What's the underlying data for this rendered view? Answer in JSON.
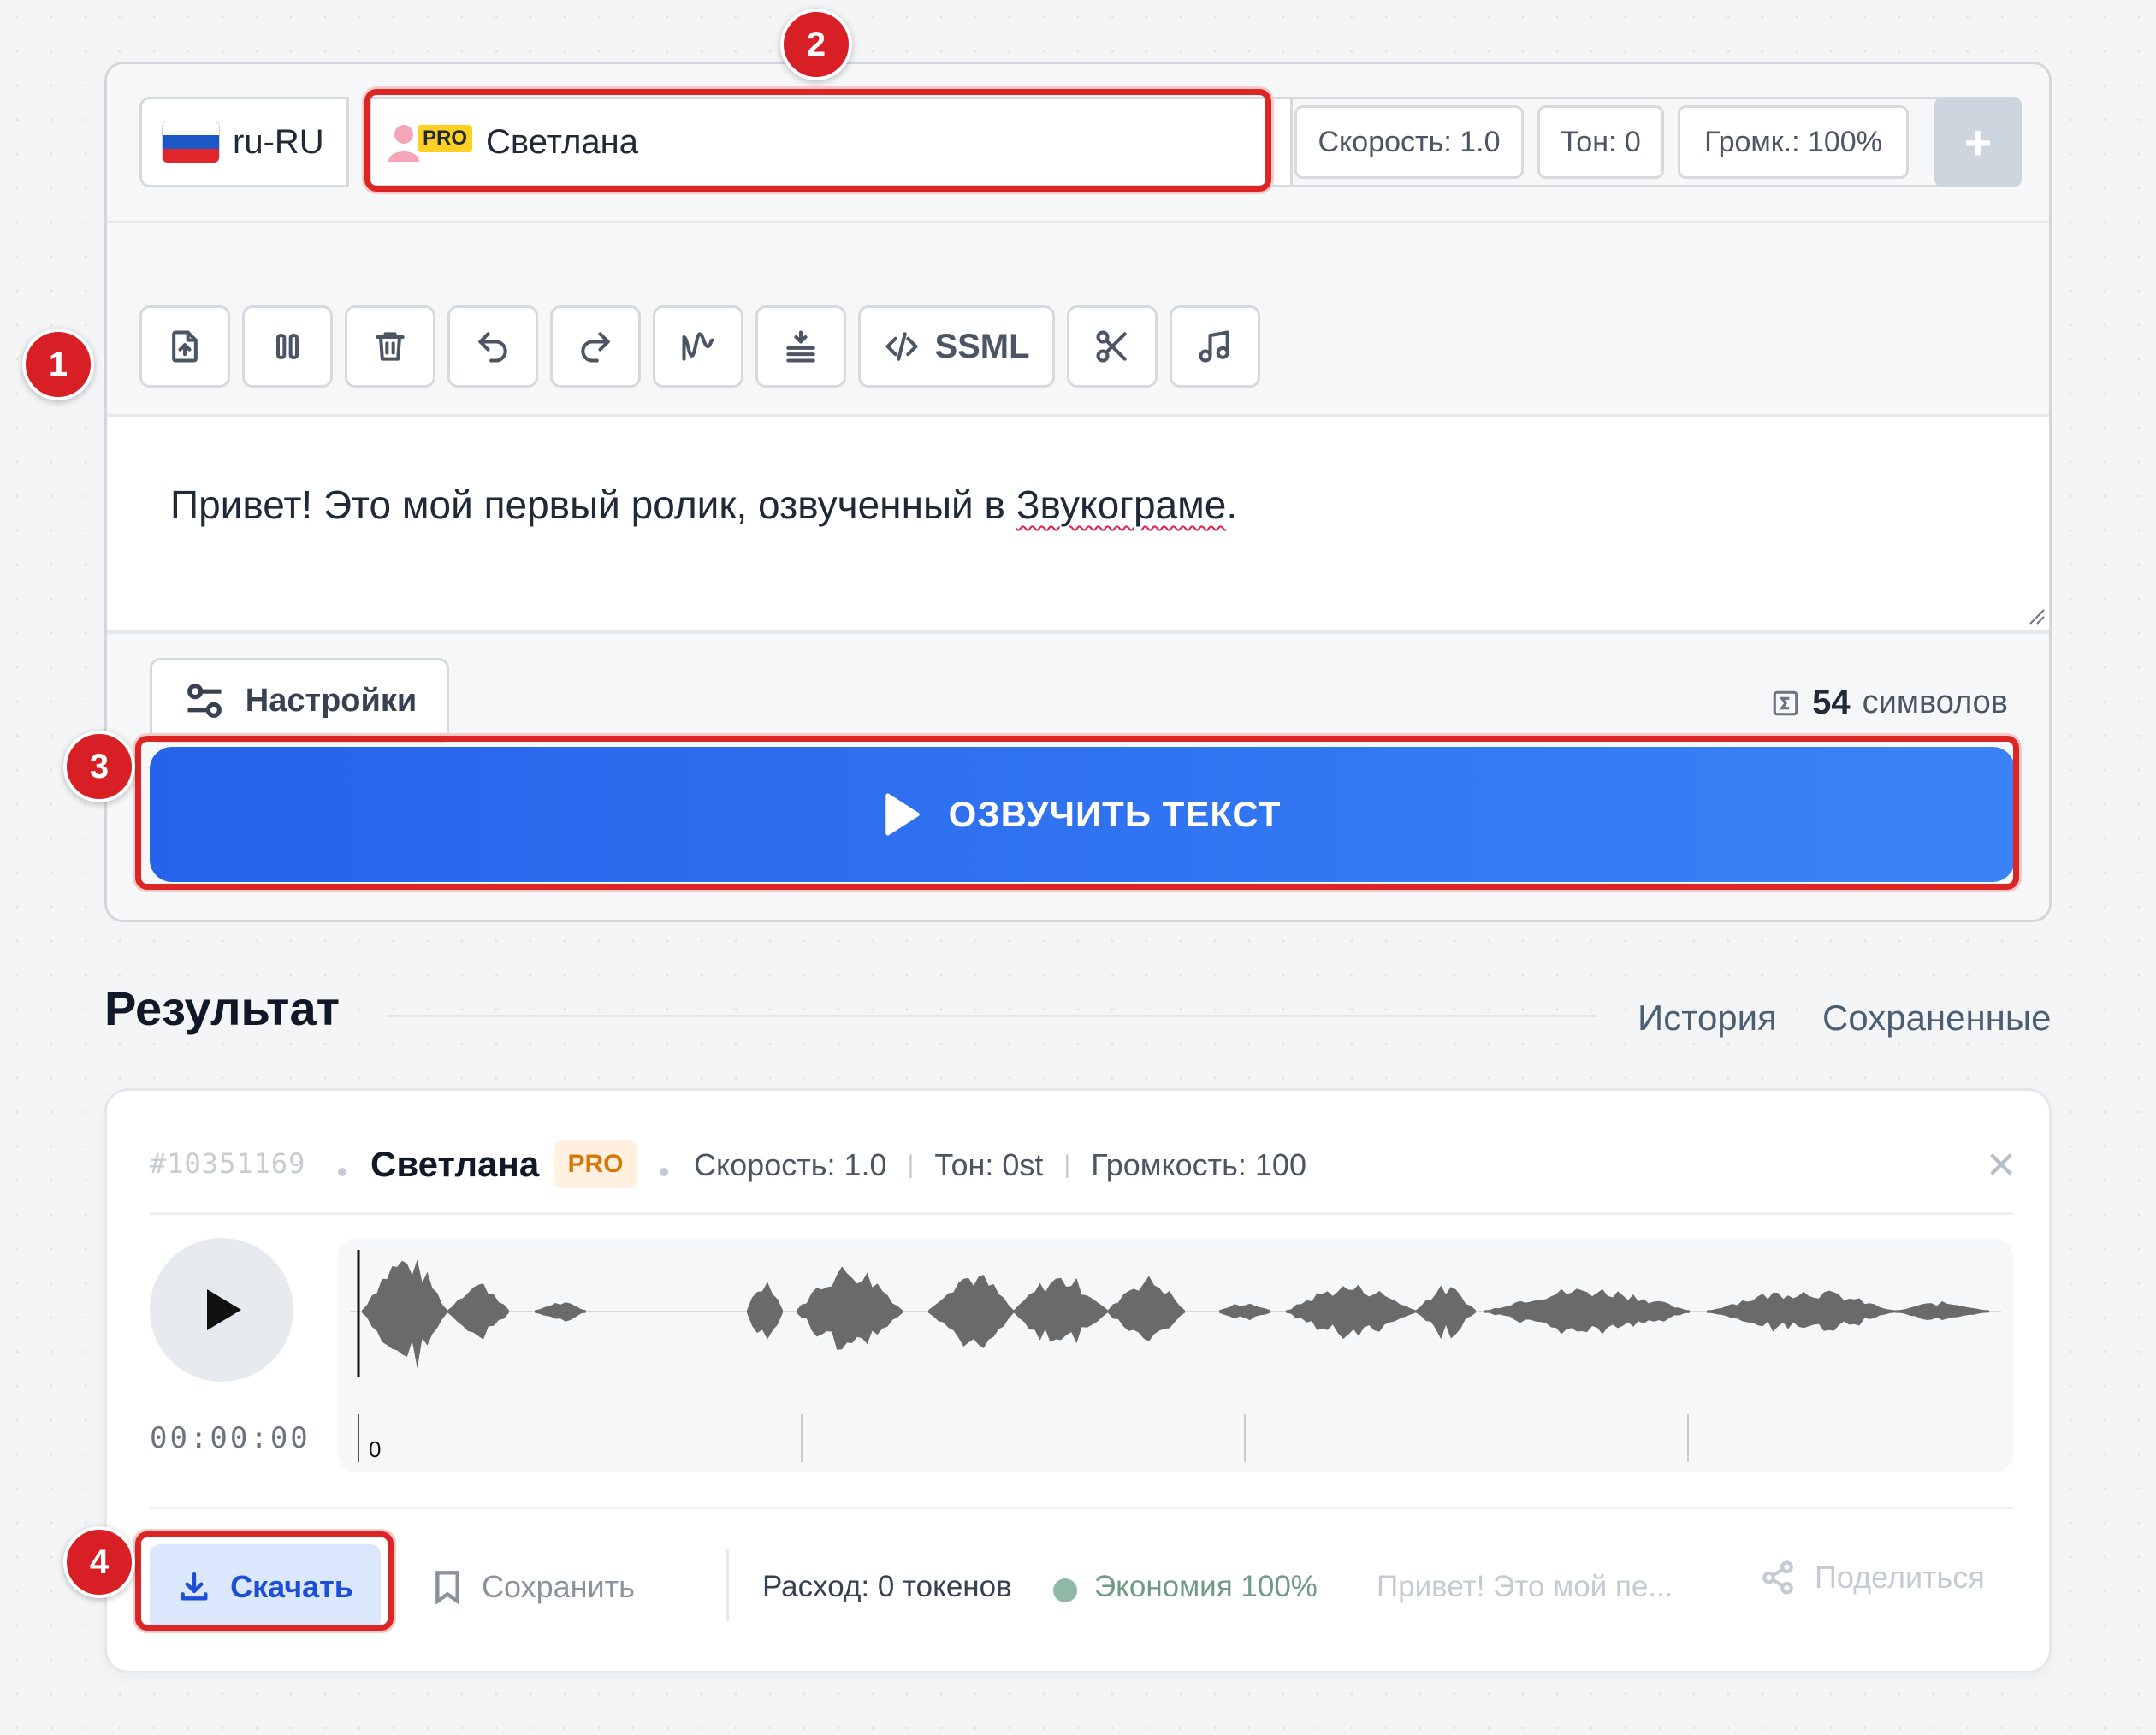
{
  "editor": {
    "language": "ru-RU",
    "voice_name": "Светлана",
    "voice_tier": "PRO",
    "params": {
      "speed": "Скорость: 1.0",
      "tone": "Тон: 0",
      "volume": "Громк.: 100%"
    },
    "add_label": "+",
    "toolbar": {
      "ssml_label": "SSML"
    },
    "text_before": "Привет! Это мой первый ролик, озвученный в ",
    "text_misspelled": "Звукограме",
    "text_after": ".",
    "settings_label": "Настройки",
    "char_count": "54",
    "char_unit": "символов",
    "speak_label": "ОЗВУЧИТЬ ТЕКСТ"
  },
  "result": {
    "title": "Результат",
    "tabs": [
      "История",
      "Сохраненные"
    ],
    "item": {
      "id": "#10351169",
      "voice": "Светлана",
      "tier": "PRO",
      "speed": "Скорость: 1.0",
      "tone": "Тон: 0st",
      "volume": "Громкость: 100",
      "time": "00:00:00",
      "axis_start": "0"
    },
    "actions": {
      "download": "Скачать",
      "save": "Сохранить",
      "cost": "Расход: 0 токенов",
      "economy": "Экономия 100%",
      "preview": "Привет! Это мой пе...",
      "share": "Поделиться"
    }
  },
  "annotations": [
    "1",
    "2",
    "3",
    "4"
  ],
  "colors": {
    "accent": "#2563eb",
    "annotation": "#dc2626",
    "pro_badge": "#d97706",
    "economy": "#6e9a86"
  }
}
